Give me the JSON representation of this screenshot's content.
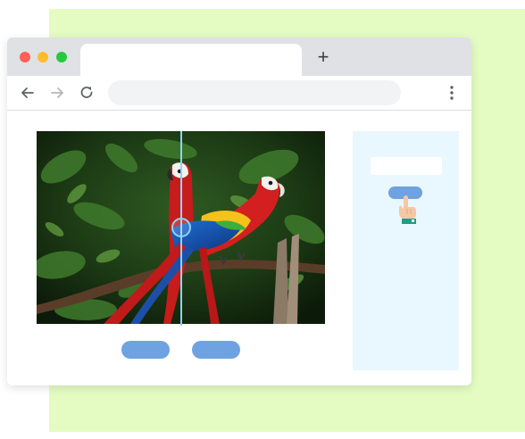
{
  "browser": {
    "window_controls": [
      "close",
      "minimize",
      "maximize"
    ],
    "active_tab": {
      "title": ""
    },
    "new_tab_label": "+",
    "toolbar": {
      "icons": [
        "back-arrow-icon",
        "forward-arrow-icon",
        "reload-icon",
        "more-menu-icon"
      ],
      "address_value": ""
    }
  },
  "content": {
    "image": {
      "subject": "two-scarlet-macaws-photo"
    },
    "compare_slider": {
      "icon": "slider-handle-icon"
    },
    "buttons": [
      {
        "label": ""
      },
      {
        "label": ""
      }
    ],
    "side_panel": {
      "input_value": "",
      "button_label": "",
      "icon": "pointing-hand-icon"
    }
  },
  "colors": {
    "background_accent": "#e4fcc2",
    "tab_bar": "#dfe1e5",
    "button_blue": "#6ea2e0",
    "slider": "#8fd3f2",
    "side_panel": "#e9f7fe",
    "close": "#fe5f57",
    "minimize": "#febc2e",
    "maximize": "#28c840"
  }
}
